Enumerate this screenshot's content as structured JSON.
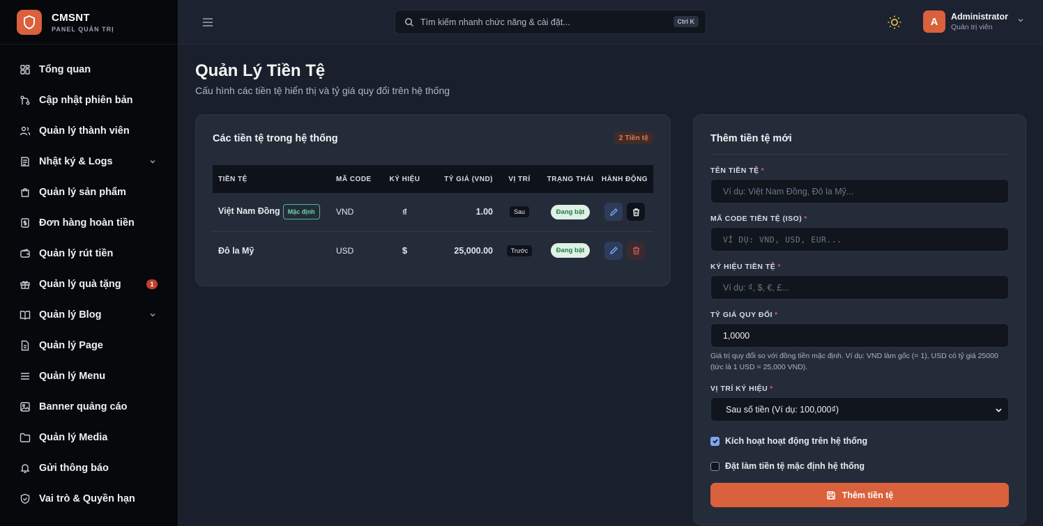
{
  "brand": {
    "name": "CMSNT",
    "subtitle": "PANEL QUẢN TRỊ",
    "logo_icon": "shield-icon"
  },
  "sidebar": {
    "items": [
      {
        "label": "Tổng quan",
        "icon": "dashboard-icon"
      },
      {
        "label": "Cập nhật phiên bản",
        "icon": "git-branch-icon"
      },
      {
        "label": "Quản lý thành viên",
        "icon": "users-icon"
      },
      {
        "label": "Nhật ký & Logs",
        "icon": "logs-icon",
        "expandable": true
      },
      {
        "label": "Quản lý sản phẩm",
        "icon": "shopping-bag-icon"
      },
      {
        "label": "Đơn hàng hoàn tiền",
        "icon": "receipt-icon"
      },
      {
        "label": "Quản lý rút tiền",
        "icon": "wallet-icon"
      },
      {
        "label": "Quản lý quà tặng",
        "icon": "gift-icon",
        "badge": "1"
      },
      {
        "label": "Quản lý Blog",
        "icon": "book-icon",
        "expandable": true
      },
      {
        "label": "Quản lý Page",
        "icon": "file-icon"
      },
      {
        "label": "Quản lý Menu",
        "icon": "menu-icon"
      },
      {
        "label": "Banner quảng cáo",
        "icon": "image-icon"
      },
      {
        "label": "Quản lý Media",
        "icon": "folder-icon"
      },
      {
        "label": "Gửi thông báo",
        "icon": "bell-icon"
      },
      {
        "label": "Vai trò & Quyền hạn",
        "icon": "shield-check-icon"
      }
    ]
  },
  "header": {
    "search_placeholder": "Tìm kiếm nhanh chức năng & cài đặt...",
    "search_shortcut": "Ctrl K",
    "theme_icon": "sun-icon",
    "user": {
      "initial": "A",
      "name": "Administrator",
      "role": "Quản trị viên"
    }
  },
  "page": {
    "title": "Quản Lý Tiền Tệ",
    "subtitle": "Cấu hình các tiền tệ hiển thị và tỷ giá quy đổi trên hệ thống"
  },
  "currency_list": {
    "title": "Các tiền tệ trong hệ thống",
    "count_badge": "2 Tiền tệ",
    "columns": [
      "TIỀN TỆ",
      "MÃ CODE",
      "KÝ HIỆU",
      "TỶ GIÁ (VND)",
      "VỊ TRÍ",
      "TRẠNG THÁI",
      "HÀNH ĐỘNG"
    ],
    "rows": [
      {
        "name": "Việt Nam Đồng",
        "default_badge": "Mặc định",
        "code": "VND",
        "symbol": "₫",
        "rate": "1.00",
        "position": "Sau",
        "status": "Đang bật"
      },
      {
        "name": "Đô la Mỹ",
        "default_badge": "",
        "code": "USD",
        "symbol": "$",
        "rate": "25,000.00",
        "position": "Trước",
        "status": "Đang bật"
      }
    ]
  },
  "form": {
    "title": "Thêm tiền tệ mới",
    "name_label": "TÊN TIỀN TỆ",
    "name_placeholder": "Ví dụ: Việt Nam Đồng, Đô la Mỹ...",
    "code_label": "MÃ CODE TIỀN TỆ (ISO)",
    "code_placeholder": "VÍ DỤ: VND, USD, EUR...",
    "symbol_label": "KÝ HIỆU TIỀN TỆ",
    "symbol_placeholder": "Ví dụ: ₫, $, €, £...",
    "rate_label": "TỶ GIÁ QUY ĐỔI",
    "rate_value": "1,0000",
    "rate_hint": "Giá trị quy đổi so với đồng tiền mặc định. Ví dụ: VND làm gốc (= 1), USD có tỷ giá 25000 (tức là 1 USD = 25,000 VND).",
    "position_label": "VỊ TRÍ KÝ HIỆU",
    "position_value": "Sau số tiền (Ví dụ: 100,000₫)",
    "required_mark": "*",
    "active_label": "Kích hoạt hoạt động trên hệ thống",
    "active_checked": true,
    "default_label": "Đặt làm tiền tệ mặc định hệ thống",
    "default_checked": false,
    "submit_label": "Thêm tiền tệ"
  },
  "colors": {
    "accent": "#d9613c",
    "background": "#1a202b",
    "card": "#252c39",
    "sidebar": "#06080c",
    "success": "#1f7a48"
  }
}
